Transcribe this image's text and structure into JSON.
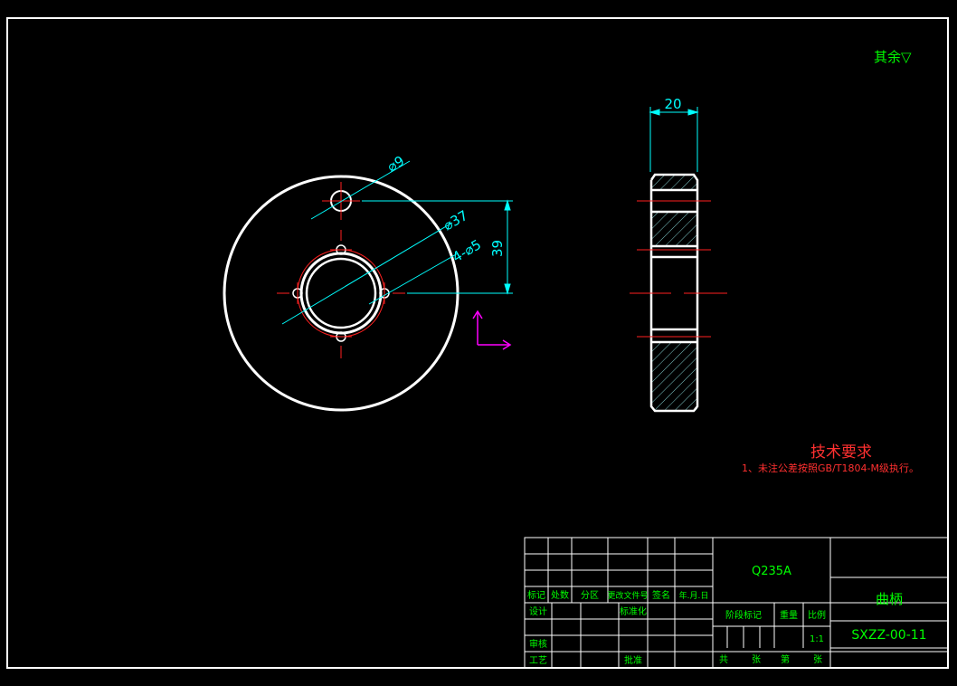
{
  "colors": {
    "background": "#000000",
    "outline": "#ffffff",
    "dimension": "#00ffff",
    "centerline": "#ff0000",
    "red_text": "#ff3030",
    "title_text": "#00ff00",
    "ucs": "#ff00ff"
  },
  "front_view": {
    "dim_hole_dia": "⌀9",
    "dim_bore_dia": "⌀37",
    "dim_holes": "4-⌀5",
    "dim_offset": "39"
  },
  "side_view": {
    "dim_thickness": "20"
  },
  "roughness_note": "其余▽",
  "tech_req": {
    "title": "技术要求",
    "line1": "1、未注公差按照GB/T1804-M级执行。"
  },
  "title_block": {
    "material": "Q235A",
    "part_name": "曲柄",
    "drawing_number": "SXZZ-00-11",
    "rev_headers": [
      "标记",
      "处数",
      "分区",
      "更改文件号",
      "签名",
      "年.月.日"
    ],
    "designer": "设计",
    "standardization": "标准化",
    "checker": "审核",
    "process": "工艺",
    "approve": "批准",
    "stage_mark": "阶段标记",
    "weight": "重量",
    "scale": "比例",
    "scale_value": "1:1",
    "sheet_total": "共",
    "sheet_unit1": "张",
    "sheet_no": "第",
    "sheet_unit2": "张"
  }
}
